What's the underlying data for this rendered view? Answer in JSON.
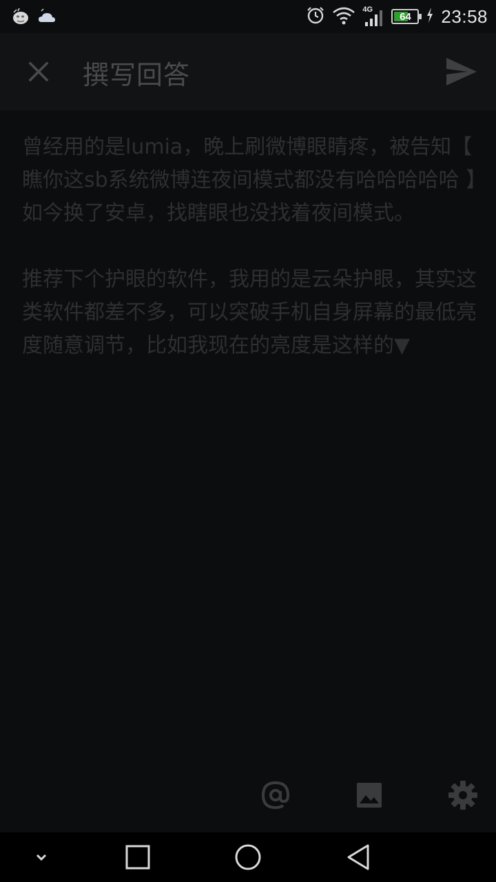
{
  "status_bar": {
    "time": "23:58",
    "battery_level": "64",
    "battery_fraction": 0.64,
    "network_type": "4G",
    "icons": [
      "app-notification-icon",
      "weather-icon",
      "alarm-icon",
      "wifi-icon",
      "signal-icon",
      "battery-icon",
      "charging-icon"
    ]
  },
  "app_bar": {
    "title": "撰写回答",
    "close_icon": "close-icon",
    "send_icon": "send-icon"
  },
  "editor": {
    "paragraphs": [
      "曾经用的是lumia，晚上刷微博眼睛疼，被告知【 瞧你这sb系统微博连夜间模式都没有哈哈哈哈哈 】如今换了安卓，找瞎眼也没找着夜间模式。",
      "推荐下个护眼的软件，我用的是云朵护眼，其实这类软件都差不多，可以突破手机自身屏幕的最低亮度随意调节，比如我现在的亮度是这样的▼"
    ]
  },
  "toolbar": {
    "items": [
      "at-mention-icon",
      "image-icon",
      "settings-gear-icon"
    ]
  },
  "nav_bar": {
    "items": [
      "collapse-chevron-icon",
      "recent-apps-icon",
      "home-icon",
      "back-icon"
    ]
  },
  "colors": {
    "background": "#0c0d0e",
    "app_bar": "#121314",
    "title_text": "#4a4b4d",
    "body_text": "#2d2f31",
    "icon": "#3a3b3d",
    "battery_fill": "#2f9e2f"
  }
}
